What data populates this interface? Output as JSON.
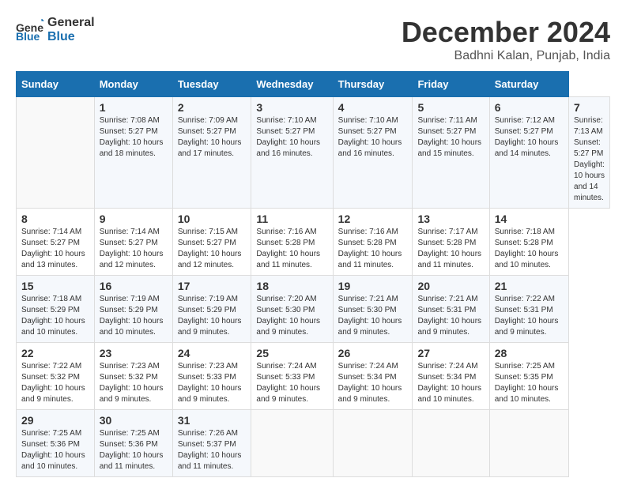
{
  "header": {
    "logo_general": "General",
    "logo_blue": "Blue",
    "title": "December 2024",
    "subtitle": "Badhni Kalan, Punjab, India"
  },
  "calendar": {
    "days_of_week": [
      "Sunday",
      "Monday",
      "Tuesday",
      "Wednesday",
      "Thursday",
      "Friday",
      "Saturday"
    ],
    "weeks": [
      [
        {
          "day": "",
          "info": ""
        },
        {
          "day": "1",
          "info": "Sunrise: 7:08 AM\nSunset: 5:27 PM\nDaylight: 10 hours\nand 18 minutes."
        },
        {
          "day": "2",
          "info": "Sunrise: 7:09 AM\nSunset: 5:27 PM\nDaylight: 10 hours\nand 17 minutes."
        },
        {
          "day": "3",
          "info": "Sunrise: 7:10 AM\nSunset: 5:27 PM\nDaylight: 10 hours\nand 16 minutes."
        },
        {
          "day": "4",
          "info": "Sunrise: 7:10 AM\nSunset: 5:27 PM\nDaylight: 10 hours\nand 16 minutes."
        },
        {
          "day": "5",
          "info": "Sunrise: 7:11 AM\nSunset: 5:27 PM\nDaylight: 10 hours\nand 15 minutes."
        },
        {
          "day": "6",
          "info": "Sunrise: 7:12 AM\nSunset: 5:27 PM\nDaylight: 10 hours\nand 14 minutes."
        },
        {
          "day": "7",
          "info": "Sunrise: 7:13 AM\nSunset: 5:27 PM\nDaylight: 10 hours\nand 14 minutes."
        }
      ],
      [
        {
          "day": "8",
          "info": "Sunrise: 7:14 AM\nSunset: 5:27 PM\nDaylight: 10 hours\nand 13 minutes."
        },
        {
          "day": "9",
          "info": "Sunrise: 7:14 AM\nSunset: 5:27 PM\nDaylight: 10 hours\nand 12 minutes."
        },
        {
          "day": "10",
          "info": "Sunrise: 7:15 AM\nSunset: 5:27 PM\nDaylight: 10 hours\nand 12 minutes."
        },
        {
          "day": "11",
          "info": "Sunrise: 7:16 AM\nSunset: 5:28 PM\nDaylight: 10 hours\nand 11 minutes."
        },
        {
          "day": "12",
          "info": "Sunrise: 7:16 AM\nSunset: 5:28 PM\nDaylight: 10 hours\nand 11 minutes."
        },
        {
          "day": "13",
          "info": "Sunrise: 7:17 AM\nSunset: 5:28 PM\nDaylight: 10 hours\nand 11 minutes."
        },
        {
          "day": "14",
          "info": "Sunrise: 7:18 AM\nSunset: 5:28 PM\nDaylight: 10 hours\nand 10 minutes."
        }
      ],
      [
        {
          "day": "15",
          "info": "Sunrise: 7:18 AM\nSunset: 5:29 PM\nDaylight: 10 hours\nand 10 minutes."
        },
        {
          "day": "16",
          "info": "Sunrise: 7:19 AM\nSunset: 5:29 PM\nDaylight: 10 hours\nand 10 minutes."
        },
        {
          "day": "17",
          "info": "Sunrise: 7:19 AM\nSunset: 5:29 PM\nDaylight: 10 hours\nand 9 minutes."
        },
        {
          "day": "18",
          "info": "Sunrise: 7:20 AM\nSunset: 5:30 PM\nDaylight: 10 hours\nand 9 minutes."
        },
        {
          "day": "19",
          "info": "Sunrise: 7:21 AM\nSunset: 5:30 PM\nDaylight: 10 hours\nand 9 minutes."
        },
        {
          "day": "20",
          "info": "Sunrise: 7:21 AM\nSunset: 5:31 PM\nDaylight: 10 hours\nand 9 minutes."
        },
        {
          "day": "21",
          "info": "Sunrise: 7:22 AM\nSunset: 5:31 PM\nDaylight: 10 hours\nand 9 minutes."
        }
      ],
      [
        {
          "day": "22",
          "info": "Sunrise: 7:22 AM\nSunset: 5:32 PM\nDaylight: 10 hours\nand 9 minutes."
        },
        {
          "day": "23",
          "info": "Sunrise: 7:23 AM\nSunset: 5:32 PM\nDaylight: 10 hours\nand 9 minutes."
        },
        {
          "day": "24",
          "info": "Sunrise: 7:23 AM\nSunset: 5:33 PM\nDaylight: 10 hours\nand 9 minutes."
        },
        {
          "day": "25",
          "info": "Sunrise: 7:24 AM\nSunset: 5:33 PM\nDaylight: 10 hours\nand 9 minutes."
        },
        {
          "day": "26",
          "info": "Sunrise: 7:24 AM\nSunset: 5:34 PM\nDaylight: 10 hours\nand 9 minutes."
        },
        {
          "day": "27",
          "info": "Sunrise: 7:24 AM\nSunset: 5:34 PM\nDaylight: 10 hours\nand 10 minutes."
        },
        {
          "day": "28",
          "info": "Sunrise: 7:25 AM\nSunset: 5:35 PM\nDaylight: 10 hours\nand 10 minutes."
        }
      ],
      [
        {
          "day": "29",
          "info": "Sunrise: 7:25 AM\nSunset: 5:36 PM\nDaylight: 10 hours\nand 10 minutes."
        },
        {
          "day": "30",
          "info": "Sunrise: 7:25 AM\nSunset: 5:36 PM\nDaylight: 10 hours\nand 11 minutes."
        },
        {
          "day": "31",
          "info": "Sunrise: 7:26 AM\nSunset: 5:37 PM\nDaylight: 10 hours\nand 11 minutes."
        },
        {
          "day": "",
          "info": ""
        },
        {
          "day": "",
          "info": ""
        },
        {
          "day": "",
          "info": ""
        },
        {
          "day": "",
          "info": ""
        }
      ]
    ]
  }
}
